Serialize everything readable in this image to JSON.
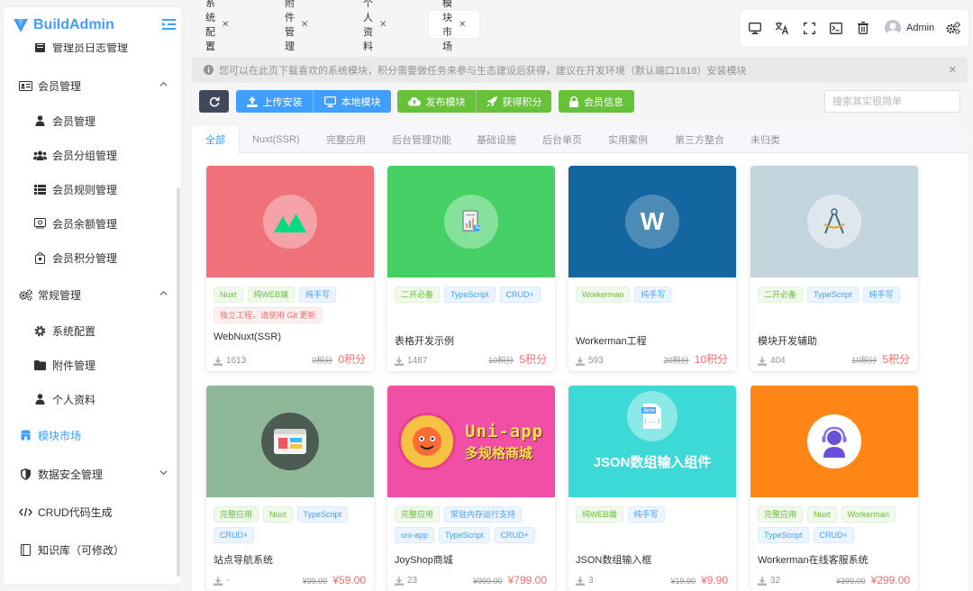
{
  "app": {
    "name": "BuildAdmin",
    "brand_color": "#409eff"
  },
  "sidebar": {
    "partial_item": "管理员日志管理",
    "items": [
      {
        "label": "会员管理",
        "icon": "vcard-icon"
      },
      {
        "label": "会员管理",
        "icon": "user-icon"
      },
      {
        "label": "会员分组管理",
        "icon": "users-icon"
      },
      {
        "label": "会员规则管理",
        "icon": "list-icon"
      },
      {
        "label": "会员余额管理",
        "icon": "money-icon"
      },
      {
        "label": "会员积分管理",
        "icon": "points-icon"
      },
      {
        "label": "常规管理",
        "icon": "cogs-icon"
      },
      {
        "label": "系统配置",
        "icon": "gear-icon"
      },
      {
        "label": "附件管理",
        "icon": "folder-icon"
      },
      {
        "label": "个人资料",
        "icon": "user-icon"
      },
      {
        "label": "模块市场",
        "icon": "shop-icon"
      },
      {
        "label": "数据安全管理",
        "icon": "shield-icon"
      },
      {
        "label": "CRUD代码生成",
        "icon": "code-icon"
      },
      {
        "label": "知识库（可修改）",
        "icon": "book-icon"
      }
    ]
  },
  "tabs": [
    {
      "label": "系统配置"
    },
    {
      "label": "附件管理"
    },
    {
      "label": "个人资料"
    },
    {
      "label": "模块市场"
    }
  ],
  "header": {
    "user": "Admin",
    "icons": [
      "desktop-icon",
      "translate-icon",
      "fullscreen-icon",
      "terminal-icon",
      "trash-icon",
      "avatar",
      "settings-icon"
    ]
  },
  "alert": {
    "text": "您可以在此页下载喜欢的系统模块，积分需要做任务来参与生态建设后获得，建议在开发环境（默认端口1818）安装模块"
  },
  "buttons": {
    "refresh": "",
    "upload": "上传安装",
    "local": "本地模块",
    "publish": "发布模块",
    "earn": "获得积分",
    "member": "会员信息"
  },
  "search": {
    "placeholder": "搜索其实很简单"
  },
  "categories": [
    "全部",
    "Nuxt(SSR)",
    "完整应用",
    "后台管理功能",
    "基础设施",
    "后台单页",
    "实用案例",
    "第三方整合",
    "未归类"
  ],
  "modules": [
    {
      "title": "WebNuxt(SSR)",
      "tags": [
        {
          "text": "Nuxt",
          "type": "success"
        },
        {
          "text": "纯WEB端",
          "type": "success"
        },
        {
          "text": "纯手写",
          "type": "primary"
        },
        {
          "text": "独立工程，请使用 Git 更新",
          "type": "danger"
        }
      ],
      "downloads": "1613",
      "old_price": "0积分",
      "price": "0积分",
      "cover": "#f0717a",
      "icon": "nuxt-logo"
    },
    {
      "title": "表格开发示例",
      "tags": [
        {
          "text": "二开必备",
          "type": "success"
        },
        {
          "text": "TypeScript",
          "type": "primary"
        },
        {
          "text": "CRUD+",
          "type": "primary"
        }
      ],
      "downloads": "1487",
      "old_price": "10积分",
      "price": "5积分",
      "cover": "#45d165",
      "icon": "report-icon"
    },
    {
      "title": "Workerman工程",
      "tags": [
        {
          "text": "Workerman",
          "type": "success"
        },
        {
          "text": "纯手写",
          "type": "primary"
        }
      ],
      "downloads": "593",
      "old_price": "20积分",
      "price": "10积分",
      "cover": "#1366a0",
      "icon": "workerman-logo"
    },
    {
      "title": "模块开发辅助",
      "tags": [
        {
          "text": "二开必备",
          "type": "success"
        },
        {
          "text": "TypeScript",
          "type": "primary"
        },
        {
          "text": "纯手写",
          "type": "primary"
        }
      ],
      "downloads": "404",
      "old_price": "10积分",
      "price": "5积分",
      "cover": "#c3d5dc",
      "icon": "compass-icon"
    },
    {
      "title": "站点导航系统",
      "tags": [
        {
          "text": "完整应用",
          "type": "success"
        },
        {
          "text": "Nuxt",
          "type": "success"
        },
        {
          "text": "TypeScript",
          "type": "primary"
        },
        {
          "text": "CRUD+",
          "type": "primary"
        }
      ],
      "downloads": "-",
      "old_price": "¥99.00",
      "price": "¥59.00",
      "cover": "#8fb899",
      "icon": "browser-icon"
    },
    {
      "title": "JoyShop商城",
      "tags": [
        {
          "text": "完整应用",
          "type": "success"
        },
        {
          "text": "常驻内存运行支持",
          "type": "primary"
        },
        {
          "text": "uni-app",
          "type": "primary"
        },
        {
          "text": "TypeScript",
          "type": "primary"
        },
        {
          "text": "CRUD+",
          "type": "primary"
        }
      ],
      "downloads": "23",
      "old_price": "¥999.00",
      "price": "¥799.00",
      "cover": "#f04fa5",
      "icon": "joyshop-logo",
      "cover_text": "Uni-app",
      "cover_sub": "多规格商城"
    },
    {
      "title": "JSON数组输入框",
      "tags": [
        {
          "text": "纯WEB端",
          "type": "success"
        },
        {
          "text": "纯手写",
          "type": "primary"
        }
      ],
      "downloads": "3",
      "old_price": "¥19.90",
      "price": "¥9.90",
      "cover": "#3dd9d6",
      "icon": "json-file-icon",
      "cover_text": "JSON数组输入组件"
    },
    {
      "title": "Workerman在线客服系统",
      "tags": [
        {
          "text": "完整应用",
          "type": "success"
        },
        {
          "text": "Nuxt",
          "type": "success"
        },
        {
          "text": "Workerman",
          "type": "success"
        },
        {
          "text": "TypeScript",
          "type": "primary"
        },
        {
          "text": "CRUD+",
          "type": "primary"
        }
      ],
      "downloads": "32",
      "old_price": "¥399.00",
      "price": "¥299.00",
      "cover": "#ff8614",
      "icon": "support-icon"
    }
  ]
}
